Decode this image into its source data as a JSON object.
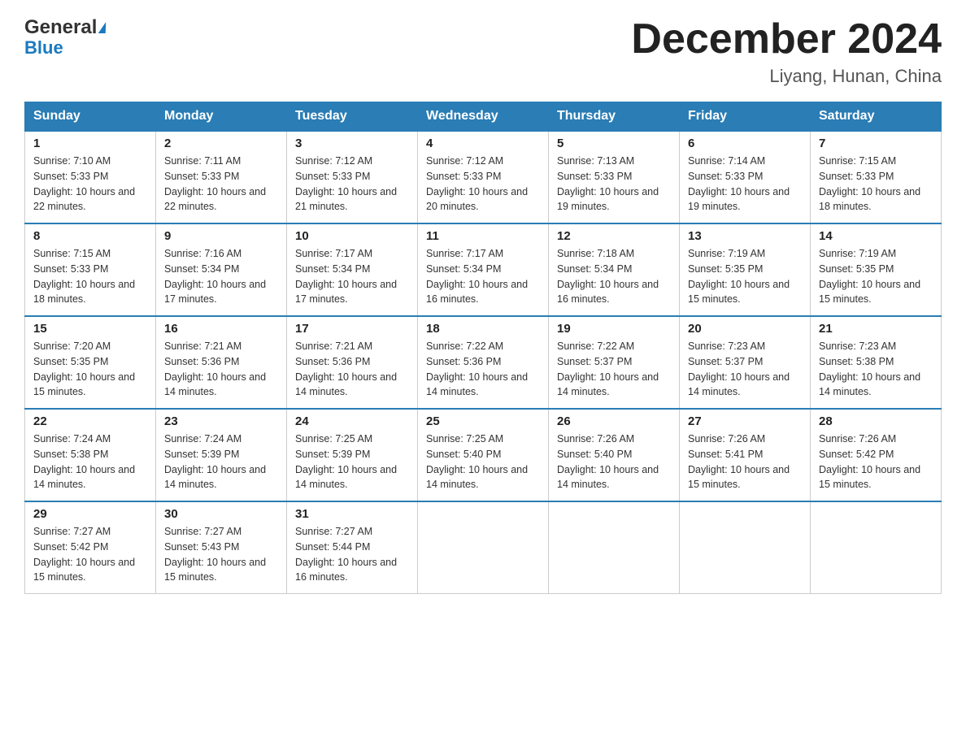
{
  "header": {
    "logo_line1": "General",
    "logo_line2": "Blue",
    "month_title": "December 2024",
    "location": "Liyang, Hunan, China"
  },
  "weekdays": [
    "Sunday",
    "Monday",
    "Tuesday",
    "Wednesday",
    "Thursday",
    "Friday",
    "Saturday"
  ],
  "weeks": [
    [
      {
        "day": "1",
        "sunrise": "7:10 AM",
        "sunset": "5:33 PM",
        "daylight": "10 hours and 22 minutes."
      },
      {
        "day": "2",
        "sunrise": "7:11 AM",
        "sunset": "5:33 PM",
        "daylight": "10 hours and 22 minutes."
      },
      {
        "day": "3",
        "sunrise": "7:12 AM",
        "sunset": "5:33 PM",
        "daylight": "10 hours and 21 minutes."
      },
      {
        "day": "4",
        "sunrise": "7:12 AM",
        "sunset": "5:33 PM",
        "daylight": "10 hours and 20 minutes."
      },
      {
        "day": "5",
        "sunrise": "7:13 AM",
        "sunset": "5:33 PM",
        "daylight": "10 hours and 19 minutes."
      },
      {
        "day": "6",
        "sunrise": "7:14 AM",
        "sunset": "5:33 PM",
        "daylight": "10 hours and 19 minutes."
      },
      {
        "day": "7",
        "sunrise": "7:15 AM",
        "sunset": "5:33 PM",
        "daylight": "10 hours and 18 minutes."
      }
    ],
    [
      {
        "day": "8",
        "sunrise": "7:15 AM",
        "sunset": "5:33 PM",
        "daylight": "10 hours and 18 minutes."
      },
      {
        "day": "9",
        "sunrise": "7:16 AM",
        "sunset": "5:34 PM",
        "daylight": "10 hours and 17 minutes."
      },
      {
        "day": "10",
        "sunrise": "7:17 AM",
        "sunset": "5:34 PM",
        "daylight": "10 hours and 17 minutes."
      },
      {
        "day": "11",
        "sunrise": "7:17 AM",
        "sunset": "5:34 PM",
        "daylight": "10 hours and 16 minutes."
      },
      {
        "day": "12",
        "sunrise": "7:18 AM",
        "sunset": "5:34 PM",
        "daylight": "10 hours and 16 minutes."
      },
      {
        "day": "13",
        "sunrise": "7:19 AM",
        "sunset": "5:35 PM",
        "daylight": "10 hours and 15 minutes."
      },
      {
        "day": "14",
        "sunrise": "7:19 AM",
        "sunset": "5:35 PM",
        "daylight": "10 hours and 15 minutes."
      }
    ],
    [
      {
        "day": "15",
        "sunrise": "7:20 AM",
        "sunset": "5:35 PM",
        "daylight": "10 hours and 15 minutes."
      },
      {
        "day": "16",
        "sunrise": "7:21 AM",
        "sunset": "5:36 PM",
        "daylight": "10 hours and 14 minutes."
      },
      {
        "day": "17",
        "sunrise": "7:21 AM",
        "sunset": "5:36 PM",
        "daylight": "10 hours and 14 minutes."
      },
      {
        "day": "18",
        "sunrise": "7:22 AM",
        "sunset": "5:36 PM",
        "daylight": "10 hours and 14 minutes."
      },
      {
        "day": "19",
        "sunrise": "7:22 AM",
        "sunset": "5:37 PM",
        "daylight": "10 hours and 14 minutes."
      },
      {
        "day": "20",
        "sunrise": "7:23 AM",
        "sunset": "5:37 PM",
        "daylight": "10 hours and 14 minutes."
      },
      {
        "day": "21",
        "sunrise": "7:23 AM",
        "sunset": "5:38 PM",
        "daylight": "10 hours and 14 minutes."
      }
    ],
    [
      {
        "day": "22",
        "sunrise": "7:24 AM",
        "sunset": "5:38 PM",
        "daylight": "10 hours and 14 minutes."
      },
      {
        "day": "23",
        "sunrise": "7:24 AM",
        "sunset": "5:39 PM",
        "daylight": "10 hours and 14 minutes."
      },
      {
        "day": "24",
        "sunrise": "7:25 AM",
        "sunset": "5:39 PM",
        "daylight": "10 hours and 14 minutes."
      },
      {
        "day": "25",
        "sunrise": "7:25 AM",
        "sunset": "5:40 PM",
        "daylight": "10 hours and 14 minutes."
      },
      {
        "day": "26",
        "sunrise": "7:26 AM",
        "sunset": "5:40 PM",
        "daylight": "10 hours and 14 minutes."
      },
      {
        "day": "27",
        "sunrise": "7:26 AM",
        "sunset": "5:41 PM",
        "daylight": "10 hours and 15 minutes."
      },
      {
        "day": "28",
        "sunrise": "7:26 AM",
        "sunset": "5:42 PM",
        "daylight": "10 hours and 15 minutes."
      }
    ],
    [
      {
        "day": "29",
        "sunrise": "7:27 AM",
        "sunset": "5:42 PM",
        "daylight": "10 hours and 15 minutes."
      },
      {
        "day": "30",
        "sunrise": "7:27 AM",
        "sunset": "5:43 PM",
        "daylight": "10 hours and 15 minutes."
      },
      {
        "day": "31",
        "sunrise": "7:27 AM",
        "sunset": "5:44 PM",
        "daylight": "10 hours and 16 minutes."
      },
      null,
      null,
      null,
      null
    ]
  ]
}
